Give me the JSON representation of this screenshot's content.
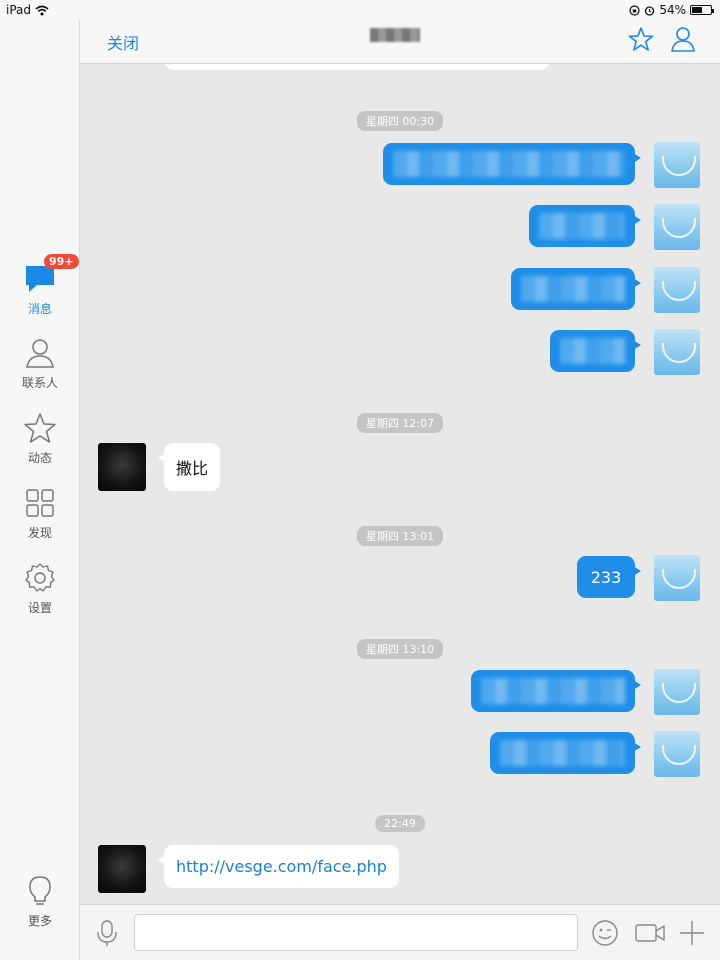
{
  "status_bar": {
    "device": "iPad",
    "battery": "54%",
    "battery_level": 0.54
  },
  "topbar": {
    "close_label": "关闭"
  },
  "sidebar": {
    "items": [
      {
        "label": "消息",
        "icon": "chat-bubble-icon",
        "badge": "99+",
        "active": true
      },
      {
        "label": "联系人",
        "icon": "person-icon"
      },
      {
        "label": "动态",
        "icon": "star-icon"
      },
      {
        "label": "发现",
        "icon": "grid-icon"
      },
      {
        "label": "设置",
        "icon": "gear-icon"
      }
    ],
    "more_label": "更多"
  },
  "chat": {
    "timestamps": [
      "星期四 00:30",
      "星期四 12:07",
      "星期四 13:01",
      "星期四 13:10",
      "22:49"
    ],
    "messages": [
      {
        "from": "me",
        "blurred": true
      },
      {
        "from": "me",
        "blurred": true
      },
      {
        "from": "me",
        "blurred": true
      },
      {
        "from": "me",
        "blurred": true
      },
      {
        "from": "other",
        "text": "撒比"
      },
      {
        "from": "me",
        "text": "233"
      },
      {
        "from": "me",
        "blurred": true
      },
      {
        "from": "me",
        "blurred": true
      },
      {
        "from": "other",
        "text": "http://vesge.com/face.php",
        "is_link": true
      }
    ]
  },
  "input": {
    "placeholder": ""
  },
  "colors": {
    "accent": "#1a8ae6",
    "bubble_me": "#1e8ee8",
    "badge": "#f04a3a"
  }
}
